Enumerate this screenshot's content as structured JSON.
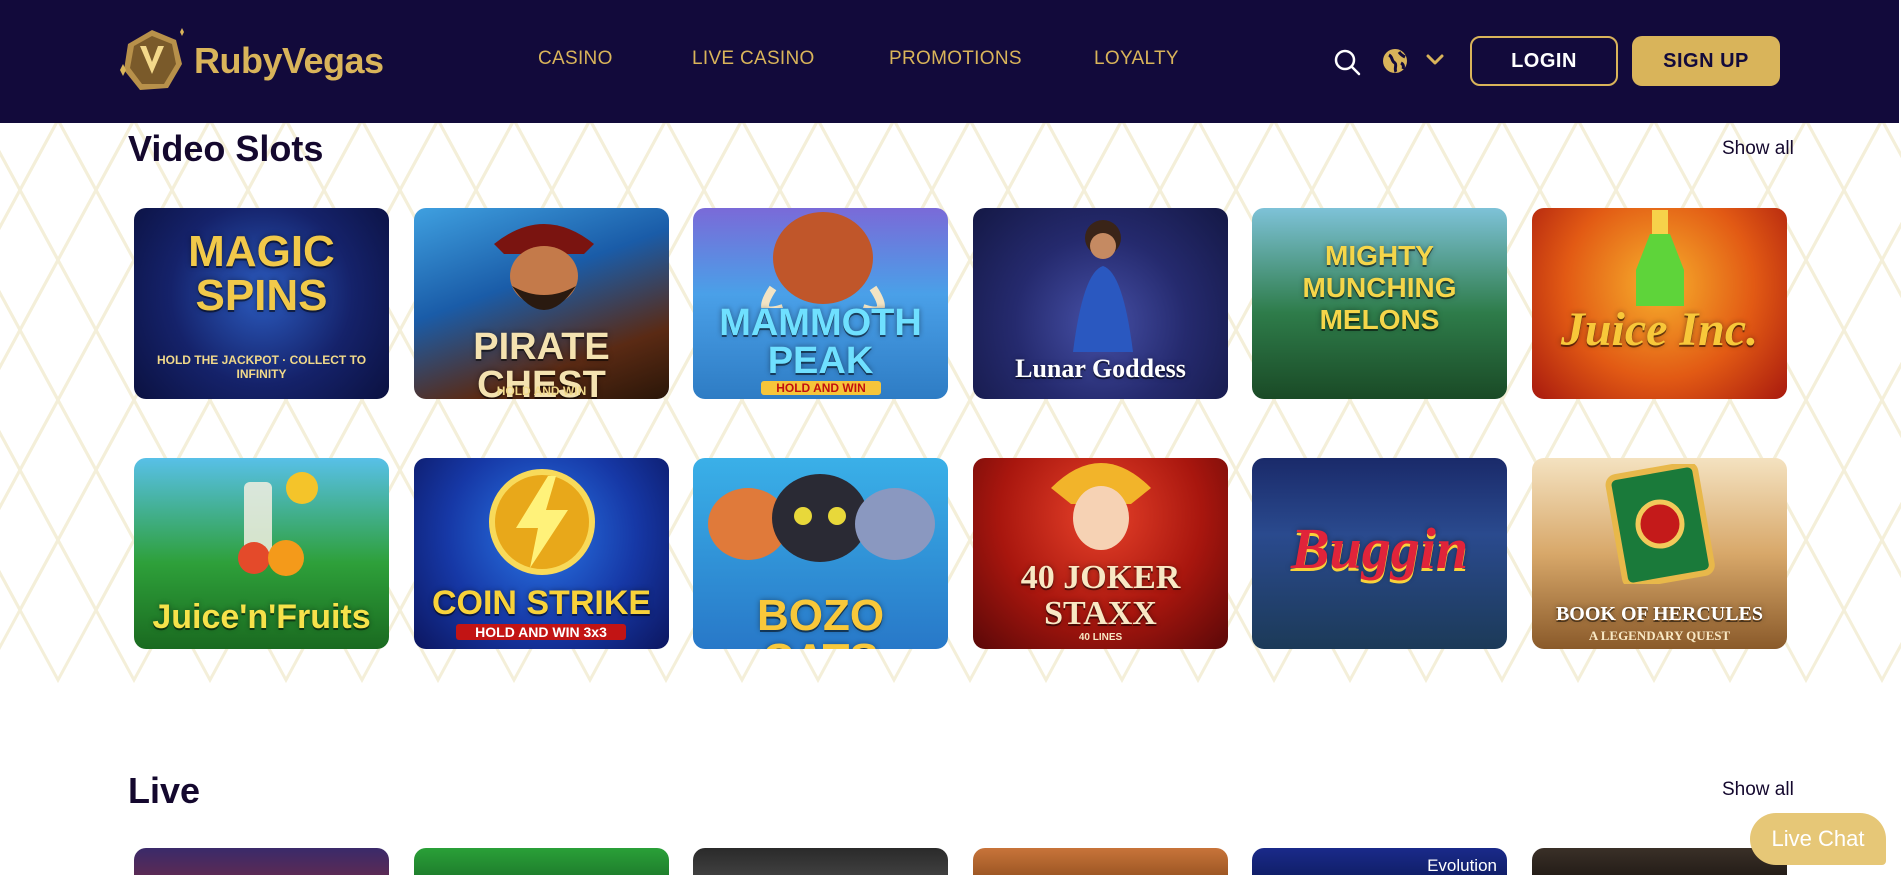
{
  "brand": {
    "name": "RubyVegas",
    "logo_letter": "V"
  },
  "colors": {
    "header_bg": "#120a3b",
    "accent": "#d9b45a",
    "text_dark": "#14082e"
  },
  "nav": {
    "items": [
      {
        "label": "CASINO"
      },
      {
        "label": "LIVE CASINO"
      },
      {
        "label": "PROMOTIONS"
      },
      {
        "label": "LOYALTY"
      }
    ],
    "icons": [
      "search-icon",
      "globe-icon",
      "chevron-down-icon"
    ],
    "login_label": "LOGIN",
    "signup_label": "SIGN UP"
  },
  "sections": [
    {
      "title": "Video Slots",
      "show_all": "Show all",
      "games": [
        {
          "title": "MAGIC SPINS",
          "sub": "HOLD THE JACKPOT · COLLECT TO INFINITY"
        },
        {
          "title": "PIRATE CHEST",
          "sub": "HOLD AND WIN"
        },
        {
          "title": "MAMMOTH PEAK",
          "sub": "HOLD AND WIN"
        },
        {
          "title": "Lunar Goddess",
          "sub": ""
        },
        {
          "title": "MIGHTY MUNCHING MELONS",
          "sub": ""
        },
        {
          "title": "Juice Inc.",
          "sub": ""
        },
        {
          "title": "Juice'n'Fruits",
          "sub": ""
        },
        {
          "title": "COIN STRIKE",
          "sub": "HOLD AND WIN 3x3"
        },
        {
          "title": "BOZO CATS",
          "sub": ""
        },
        {
          "title": "40 JOKER STAXX",
          "sub": "40 LINES"
        },
        {
          "title": "Buggin",
          "sub": ""
        },
        {
          "title": "BOOK OF HERCULES",
          "sub": "A LEGENDARY QUEST"
        }
      ]
    },
    {
      "title": "Live",
      "show_all": "Show all",
      "partial_labels": [
        "Evolution"
      ]
    }
  ],
  "live_chat": {
    "label": "Live Chat"
  }
}
